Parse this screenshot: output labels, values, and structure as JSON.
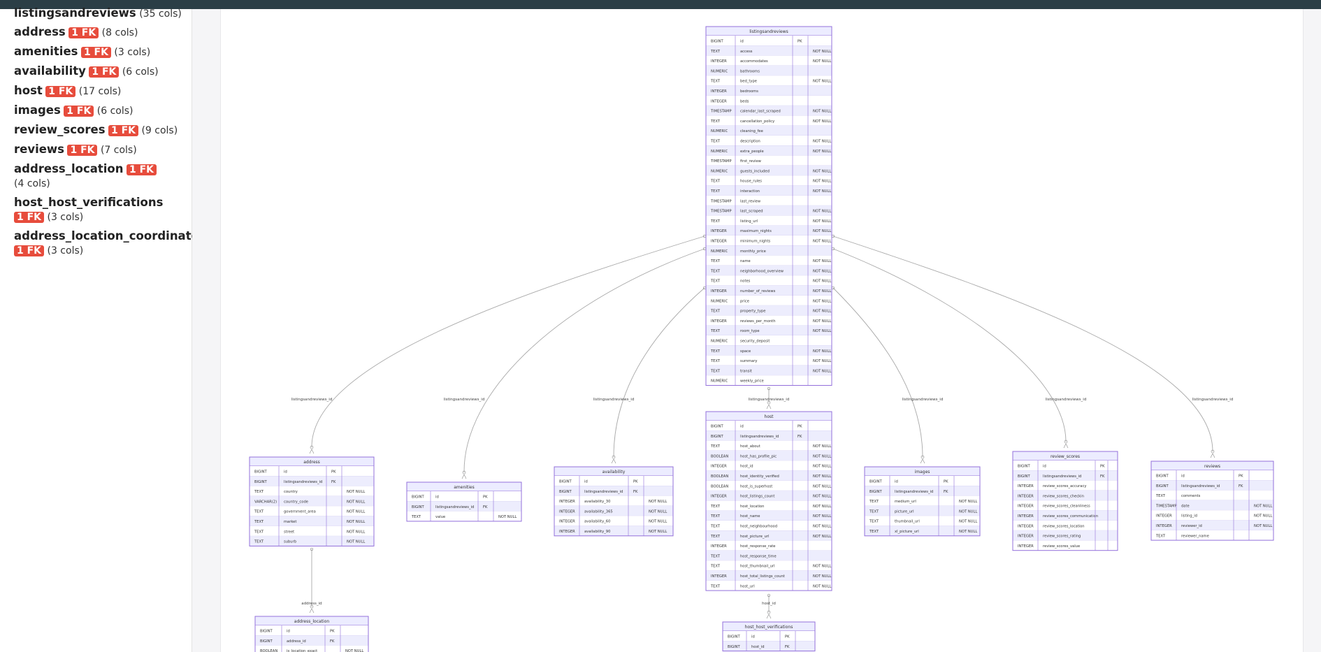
{
  "sidebar": {
    "items": [
      {
        "name": "listingsandreviews",
        "fk": "",
        "cols": "(35 cols)"
      },
      {
        "name": "address",
        "fk": "1 FK",
        "cols": "(8 cols)"
      },
      {
        "name": "amenities",
        "fk": "1 FK",
        "cols": "(3 cols)"
      },
      {
        "name": "availability",
        "fk": "1 FK",
        "cols": "(6 cols)"
      },
      {
        "name": "host",
        "fk": "1 FK",
        "cols": "(17 cols)"
      },
      {
        "name": "images",
        "fk": "1 FK",
        "cols": "(6 cols)"
      },
      {
        "name": "review_scores",
        "fk": "1 FK",
        "cols": "(9 cols)"
      },
      {
        "name": "reviews",
        "fk": "1 FK",
        "cols": "(7 cols)"
      },
      {
        "name": "address_location",
        "fk": "1 FK",
        "cols": "(4 cols)"
      },
      {
        "name": "host_host_verifications",
        "fk": "1 FK",
        "cols": "(3 cols)"
      },
      {
        "name": "address_location_coordinates",
        "fk": "1 FK",
        "cols": "(3 cols)"
      }
    ]
  },
  "colors": {
    "badge": "#e74c3c",
    "table_border": "#9370db",
    "table_header": "#ececff",
    "row_alt": "#ededfd"
  },
  "diagram": {
    "tables": [
      {
        "id": "listingsandreviews",
        "title": "listingsandreviews",
        "rows": [
          [
            "BIGINT",
            "id",
            "PK",
            ""
          ],
          [
            "TEXT",
            "access",
            "",
            "NOT NULL"
          ],
          [
            "INTEGER",
            "accommodates",
            "",
            "NOT NULL"
          ],
          [
            "NUMERIC",
            "bathrooms",
            "",
            ""
          ],
          [
            "TEXT",
            "bed_type",
            "",
            "NOT NULL"
          ],
          [
            "INTEGER",
            "bedrooms",
            "",
            ""
          ],
          [
            "INTEGER",
            "beds",
            "",
            ""
          ],
          [
            "TIMESTAMP",
            "calendar_last_scraped",
            "",
            "NOT NULL"
          ],
          [
            "TEXT",
            "cancellation_policy",
            "",
            "NOT NULL"
          ],
          [
            "NUMERIC",
            "cleaning_fee",
            "",
            ""
          ],
          [
            "TEXT",
            "description",
            "",
            "NOT NULL"
          ],
          [
            "NUMERIC",
            "extra_people",
            "",
            "NOT NULL"
          ],
          [
            "TIMESTAMP",
            "first_review",
            "",
            ""
          ],
          [
            "NUMERIC",
            "guests_included",
            "",
            "NOT NULL"
          ],
          [
            "TEXT",
            "house_rules",
            "",
            "NOT NULL"
          ],
          [
            "TEXT",
            "interaction",
            "",
            "NOT NULL"
          ],
          [
            "TIMESTAMP",
            "last_review",
            "",
            ""
          ],
          [
            "TIMESTAMP",
            "last_scraped",
            "",
            "NOT NULL"
          ],
          [
            "TEXT",
            "listing_url",
            "",
            "NOT NULL"
          ],
          [
            "INTEGER",
            "maximum_nights",
            "",
            "NOT NULL"
          ],
          [
            "INTEGER",
            "minimum_nights",
            "",
            "NOT NULL"
          ],
          [
            "NUMERIC",
            "monthly_price",
            "",
            ""
          ],
          [
            "TEXT",
            "name",
            "",
            "NOT NULL"
          ],
          [
            "TEXT",
            "neighborhood_overview",
            "",
            "NOT NULL"
          ],
          [
            "TEXT",
            "notes",
            "",
            "NOT NULL"
          ],
          [
            "INTEGER",
            "number_of_reviews",
            "",
            "NOT NULL"
          ],
          [
            "NUMERIC",
            "price",
            "",
            "NOT NULL"
          ],
          [
            "TEXT",
            "property_type",
            "",
            "NOT NULL"
          ],
          [
            "INTEGER",
            "reviews_per_month",
            "",
            "NOT NULL"
          ],
          [
            "TEXT",
            "room_type",
            "",
            "NOT NULL"
          ],
          [
            "NUMERIC",
            "security_deposit",
            "",
            ""
          ],
          [
            "TEXT",
            "space",
            "",
            "NOT NULL"
          ],
          [
            "TEXT",
            "summary",
            "",
            "NOT NULL"
          ],
          [
            "TEXT",
            "transit",
            "",
            "NOT NULL"
          ],
          [
            "NUMERIC",
            "weekly_price",
            "",
            ""
          ]
        ]
      },
      {
        "id": "address",
        "title": "address",
        "rows": [
          [
            "BIGINT",
            "id",
            "PK",
            ""
          ],
          [
            "BIGINT",
            "listingsandreviews_id",
            "FK",
            ""
          ],
          [
            "TEXT",
            "country",
            "",
            "NOT NULL"
          ],
          [
            "VARCHAR(2)",
            "country_code",
            "",
            "NOT NULL"
          ],
          [
            "TEXT",
            "government_area",
            "",
            "NOT NULL"
          ],
          [
            "TEXT",
            "market",
            "",
            "NOT NULL"
          ],
          [
            "TEXT",
            "street",
            "",
            "NOT NULL"
          ],
          [
            "TEXT",
            "suburb",
            "",
            "NOT NULL"
          ]
        ]
      },
      {
        "id": "amenities",
        "title": "amenities",
        "rows": [
          [
            "BIGINT",
            "id",
            "PK",
            ""
          ],
          [
            "BIGINT",
            "listingsandreviews_id",
            "FK",
            ""
          ],
          [
            "TEXT",
            "value",
            "",
            "NOT NULL"
          ]
        ]
      },
      {
        "id": "availability",
        "title": "availability",
        "rows": [
          [
            "BIGINT",
            "id",
            "PK",
            ""
          ],
          [
            "BIGINT",
            "listingsandreviews_id",
            "FK",
            ""
          ],
          [
            "INTEGER",
            "availability_30",
            "",
            "NOT NULL"
          ],
          [
            "INTEGER",
            "availability_365",
            "",
            "NOT NULL"
          ],
          [
            "INTEGER",
            "availability_60",
            "",
            "NOT NULL"
          ],
          [
            "INTEGER",
            "availability_90",
            "",
            "NOT NULL"
          ]
        ]
      },
      {
        "id": "host",
        "title": "host",
        "rows": [
          [
            "BIGINT",
            "id",
            "PK",
            ""
          ],
          [
            "BIGINT",
            "listingsandreviews_id",
            "FK",
            ""
          ],
          [
            "TEXT",
            "host_about",
            "",
            "NOT NULL"
          ],
          [
            "BOOLEAN",
            "host_has_profile_pic",
            "",
            "NOT NULL"
          ],
          [
            "INTEGER",
            "host_id",
            "",
            "NOT NULL"
          ],
          [
            "BOOLEAN",
            "host_identity_verified",
            "",
            "NOT NULL"
          ],
          [
            "BOOLEAN",
            "host_is_superhost",
            "",
            "NOT NULL"
          ],
          [
            "INTEGER",
            "host_listings_count",
            "",
            "NOT NULL"
          ],
          [
            "TEXT",
            "host_location",
            "",
            "NOT NULL"
          ],
          [
            "TEXT",
            "host_name",
            "",
            "NOT NULL"
          ],
          [
            "TEXT",
            "host_neighbourhood",
            "",
            "NOT NULL"
          ],
          [
            "TEXT",
            "host_picture_url",
            "",
            "NOT NULL"
          ],
          [
            "INTEGER",
            "host_response_rate",
            "",
            ""
          ],
          [
            "TEXT",
            "host_response_time",
            "",
            ""
          ],
          [
            "TEXT",
            "host_thumbnail_url",
            "",
            "NOT NULL"
          ],
          [
            "INTEGER",
            "host_total_listings_count",
            "",
            "NOT NULL"
          ],
          [
            "TEXT",
            "host_url",
            "",
            "NOT NULL"
          ]
        ]
      },
      {
        "id": "images",
        "title": "images",
        "rows": [
          [
            "BIGINT",
            "id",
            "PK",
            ""
          ],
          [
            "BIGINT",
            "listingsandreviews_id",
            "FK",
            ""
          ],
          [
            "TEXT",
            "medium_url",
            "",
            "NOT NULL"
          ],
          [
            "TEXT",
            "picture_url",
            "",
            "NOT NULL"
          ],
          [
            "TEXT",
            "thumbnail_url",
            "",
            "NOT NULL"
          ],
          [
            "TEXT",
            "xl_picture_url",
            "",
            "NOT NULL"
          ]
        ]
      },
      {
        "id": "review_scores",
        "title": "review_scores",
        "rows": [
          [
            "BIGINT",
            "id",
            "PK",
            ""
          ],
          [
            "BIGINT",
            "listingsandreviews_id",
            "FK",
            ""
          ],
          [
            "INTEGER",
            "review_scores_accuracy",
            "",
            ""
          ],
          [
            "INTEGER",
            "review_scores_checkin",
            "",
            ""
          ],
          [
            "INTEGER",
            "review_scores_cleanliness",
            "",
            ""
          ],
          [
            "INTEGER",
            "review_scores_communication",
            "",
            ""
          ],
          [
            "INTEGER",
            "review_scores_location",
            "",
            ""
          ],
          [
            "INTEGER",
            "review_scores_rating",
            "",
            ""
          ],
          [
            "INTEGER",
            "review_scores_value",
            "",
            ""
          ]
        ]
      },
      {
        "id": "reviews",
        "title": "reviews",
        "rows": [
          [
            "BIGINT",
            "id",
            "PK",
            ""
          ],
          [
            "BIGINT",
            "listingsandreviews_id",
            "FK",
            ""
          ],
          [
            "TEXT",
            "comments",
            "",
            ""
          ],
          [
            "TIMESTAMP",
            "date",
            "",
            "NOT NULL"
          ],
          [
            "INTEGER",
            "listing_id",
            "",
            "NOT NULL"
          ],
          [
            "INTEGER",
            "reviewer_id",
            "",
            "NOT NULL"
          ],
          [
            "TEXT",
            "reviewer_name",
            "",
            ""
          ]
        ]
      },
      {
        "id": "address_location",
        "title": "address_location",
        "rows": [
          [
            "BIGINT",
            "id",
            "PK",
            ""
          ],
          [
            "BIGINT",
            "address_id",
            "FK",
            ""
          ],
          [
            "BOOLEAN",
            "is_location_exact",
            "",
            "NOT NULL"
          ]
        ]
      },
      {
        "id": "host_host_verifications",
        "title": "host_host_verifications",
        "rows": [
          [
            "BIGINT",
            "id",
            "PK",
            ""
          ],
          [
            "BIGINT",
            "host_id",
            "FK",
            ""
          ]
        ]
      }
    ],
    "relations": [
      {
        "from": "address",
        "to": "listingsandreviews",
        "label": "listingsandreviews_id"
      },
      {
        "from": "amenities",
        "to": "listingsandreviews",
        "label": "listingsandreviews_id"
      },
      {
        "from": "availability",
        "to": "listingsandreviews",
        "label": "listingsandreviews_id"
      },
      {
        "from": "host",
        "to": "listingsandreviews",
        "label": "listingsandreviews_id"
      },
      {
        "from": "images",
        "to": "listingsandreviews",
        "label": "listingsandreviews_id"
      },
      {
        "from": "review_scores",
        "to": "listingsandreviews",
        "label": "listingsandreviews_id"
      },
      {
        "from": "reviews",
        "to": "listingsandreviews",
        "label": "listingsandreviews_id"
      },
      {
        "from": "address_location",
        "to": "address",
        "label": "address_id"
      },
      {
        "from": "host_host_verifications",
        "to": "host",
        "label": "host_id"
      }
    ]
  }
}
